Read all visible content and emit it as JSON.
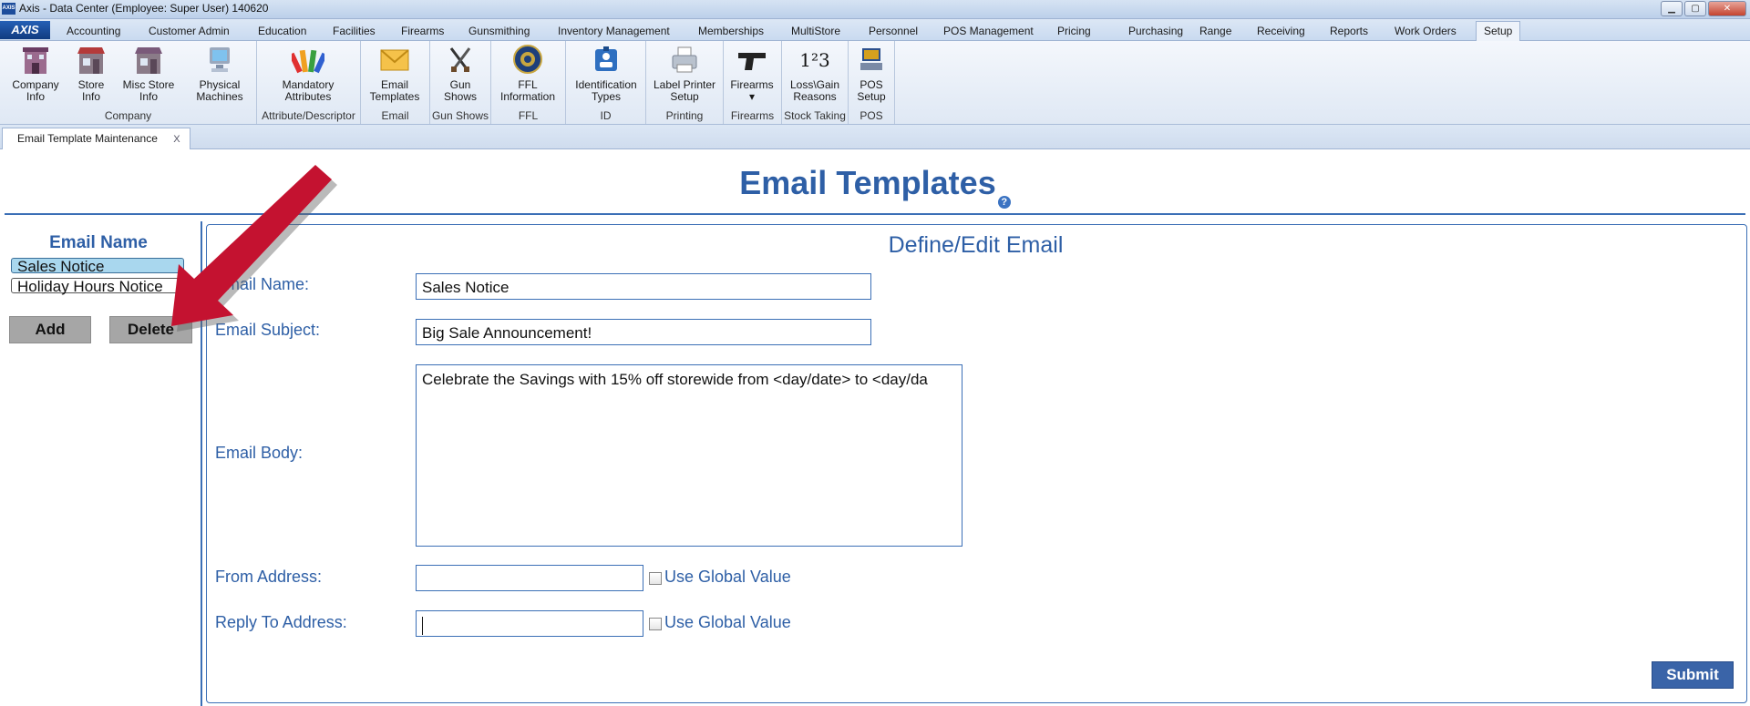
{
  "window": {
    "title": "Axis - Data Center  (Employee: Super User) 140620",
    "app_icon_text": "AXIS",
    "minimize": "▁",
    "maximize": "▢",
    "close": "✕"
  },
  "menu": {
    "logo": "AXIS",
    "tabs": [
      "Accounting",
      "Customer Admin",
      "Education",
      "Facilities",
      "Firearms",
      "Gunsmithing",
      "Inventory Management",
      "Memberships",
      "MultiStore",
      "Personnel",
      "POS Management",
      "Pricing",
      "Purchasing",
      "Range",
      "Receiving",
      "Reports",
      "Work Orders",
      "Setup"
    ],
    "active_tab": "Setup"
  },
  "ribbon": {
    "groups": [
      {
        "label": "Company",
        "buttons": [
          {
            "line1": "Company",
            "line2": "Info",
            "icon": "company-icon"
          },
          {
            "line1": "Store",
            "line2": "Info",
            "icon": "store-icon"
          },
          {
            "line1": "Misc Store",
            "line2": "Info",
            "icon": "misc-store-icon"
          },
          {
            "line1": "Physical",
            "line2": "Machines",
            "icon": "computer-icon"
          }
        ]
      },
      {
        "label": "Attribute/Descriptor",
        "buttons": [
          {
            "line1": "Mandatory",
            "line2": "Attributes",
            "icon": "color-fan-icon"
          }
        ]
      },
      {
        "label": "Email",
        "buttons": [
          {
            "line1": "Email",
            "line2": "Templates",
            "icon": "envelope-icon"
          }
        ]
      },
      {
        "label": "Gun Shows",
        "buttons": [
          {
            "line1": "Gun",
            "line2": "Shows",
            "icon": "crossed-guns-icon"
          }
        ]
      },
      {
        "label": "FFL",
        "buttons": [
          {
            "line1": "FFL",
            "line2": "Information",
            "icon": "seal-icon"
          }
        ]
      },
      {
        "label": "ID",
        "buttons": [
          {
            "line1": "Identification",
            "line2": "Types",
            "icon": "id-card-icon"
          }
        ]
      },
      {
        "label": "Printing",
        "buttons": [
          {
            "line1": "Label Printer",
            "line2": "Setup",
            "icon": "printer-icon"
          }
        ]
      },
      {
        "label": "Firearms",
        "buttons": [
          {
            "line1": "Firearms",
            "line2": "▾",
            "icon": "pistol-icon"
          }
        ]
      },
      {
        "label": "Stock Taking",
        "buttons": [
          {
            "line1": "Loss\\Gain",
            "line2": "Reasons",
            "icon": "numbers-icon"
          }
        ]
      },
      {
        "label": "POS",
        "buttons": [
          {
            "line1": "POS",
            "line2": "Setup",
            "icon": "pos-terminal-icon"
          }
        ]
      }
    ],
    "numbers_glyph": "1²3"
  },
  "doc_tabs": [
    {
      "label": "Email Template Maintenance",
      "close": "X"
    }
  ],
  "page": {
    "title": "Email Templates",
    "help": "?"
  },
  "left_panel": {
    "header": "Email Name",
    "items": [
      "Sales Notice",
      "Holiday Hours Notice"
    ],
    "selected": "Sales Notice",
    "add_label": "Add",
    "delete_label": "Delete"
  },
  "form": {
    "title": "Define/Edit Email",
    "name_label": "Email Name:",
    "name_value": "Sales Notice",
    "subject_label": "Email Subject:",
    "subject_value": "Big Sale Announcement!",
    "body_label": "Email Body:",
    "body_value": "Celebrate the Savings with 15% off storewide from <day/date> to <day/da",
    "from_label": "From Address:",
    "from_value": "",
    "reply_label": "Reply To Address:",
    "reply_value": "",
    "global_label": "Use Global Value",
    "submit_label": "Submit"
  },
  "colors": {
    "accent": "#2e5fa6",
    "arrow": "#c41230",
    "selected_row": "#a9d7ee",
    "submit": "#3a64a8"
  }
}
